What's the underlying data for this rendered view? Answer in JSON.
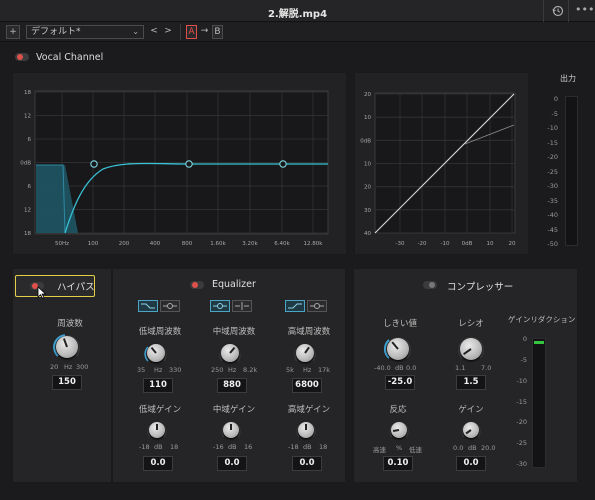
{
  "window": {
    "title": "2.解脱.mp4"
  },
  "toolbar": {
    "add_label": "+",
    "preset": "デフォルト*",
    "prev": "<",
    "next": ">",
    "a_label": "A",
    "arrow_label": "→",
    "b_label": "B"
  },
  "vocal": {
    "label": "Vocal Channel",
    "enabled": true
  },
  "eq_graph": {
    "y_ticks": [
      "18",
      "12",
      "6",
      "0dB",
      "6",
      "12",
      "18"
    ],
    "x_ticks": [
      "50Hz",
      "100",
      "200",
      "400",
      "800",
      "1.60k",
      "3.20k",
      "6.40k",
      "12.80k"
    ]
  },
  "comp_graph": {
    "y_ticks": [
      "20",
      "10",
      "0dB",
      "10",
      "20",
      "30",
      "40"
    ],
    "x_ticks": [
      "-30",
      "-20",
      "-10",
      "0dB",
      "10",
      "20"
    ]
  },
  "output": {
    "label": "出力",
    "ticks": [
      "0",
      "-5",
      "-10",
      "-15",
      "-20",
      "-25",
      "-30",
      "-35",
      "-40",
      "-45",
      "-50"
    ]
  },
  "highpass": {
    "title": "ハイパス",
    "enabled": true,
    "freq_label": "周波数",
    "freq_scale": [
      "20",
      "Hz",
      "300"
    ],
    "freq_value": "150"
  },
  "equalizer": {
    "title": "Equalizer",
    "enabled": true,
    "bands": [
      {
        "freq_label": "低域周波数",
        "scale": [
          "35",
          "Hz",
          "330"
        ],
        "freq_value": "110",
        "gain_label": "低域ゲイン",
        "gain_scale": [
          "-18",
          "dB",
          "18"
        ],
        "gain_value": "0.0"
      },
      {
        "freq_label": "中域周波数",
        "scale": [
          "250",
          "Hz",
          "8.2k"
        ],
        "freq_value": "880",
        "gain_label": "中域ゲイン",
        "gain_scale": [
          "-16",
          "dB",
          "16"
        ],
        "gain_value": "0.0"
      },
      {
        "freq_label": "高域周波数",
        "scale": [
          "5k",
          "Hz",
          "17k"
        ],
        "freq_value": "6800",
        "gain_label": "高域ゲイン",
        "gain_scale": [
          "-18",
          "dB",
          "18"
        ],
        "gain_value": "0.0"
      }
    ]
  },
  "compressor": {
    "title": "コンプレッサー",
    "enabled": false,
    "threshold_label": "しきい値",
    "threshold_scale": [
      "-40.0",
      "dB",
      "0.0"
    ],
    "threshold_value": "-25.0",
    "ratio_label": "レシオ",
    "ratio_scale": [
      "1.1",
      "7.0"
    ],
    "ratio_value": "1.5",
    "response_label": "反応",
    "response_scale": [
      "高速",
      "%",
      "低速"
    ],
    "response_value": "0.10",
    "gain_label": "ゲイン",
    "gain_scale": [
      "0.0",
      "dB",
      "20.0"
    ],
    "gain_value": "0.0",
    "gr_label": "ゲインリダクション",
    "gr_ticks": [
      "0",
      "-5",
      "-10",
      "-15",
      "-20",
      "-25",
      "-30"
    ]
  }
}
